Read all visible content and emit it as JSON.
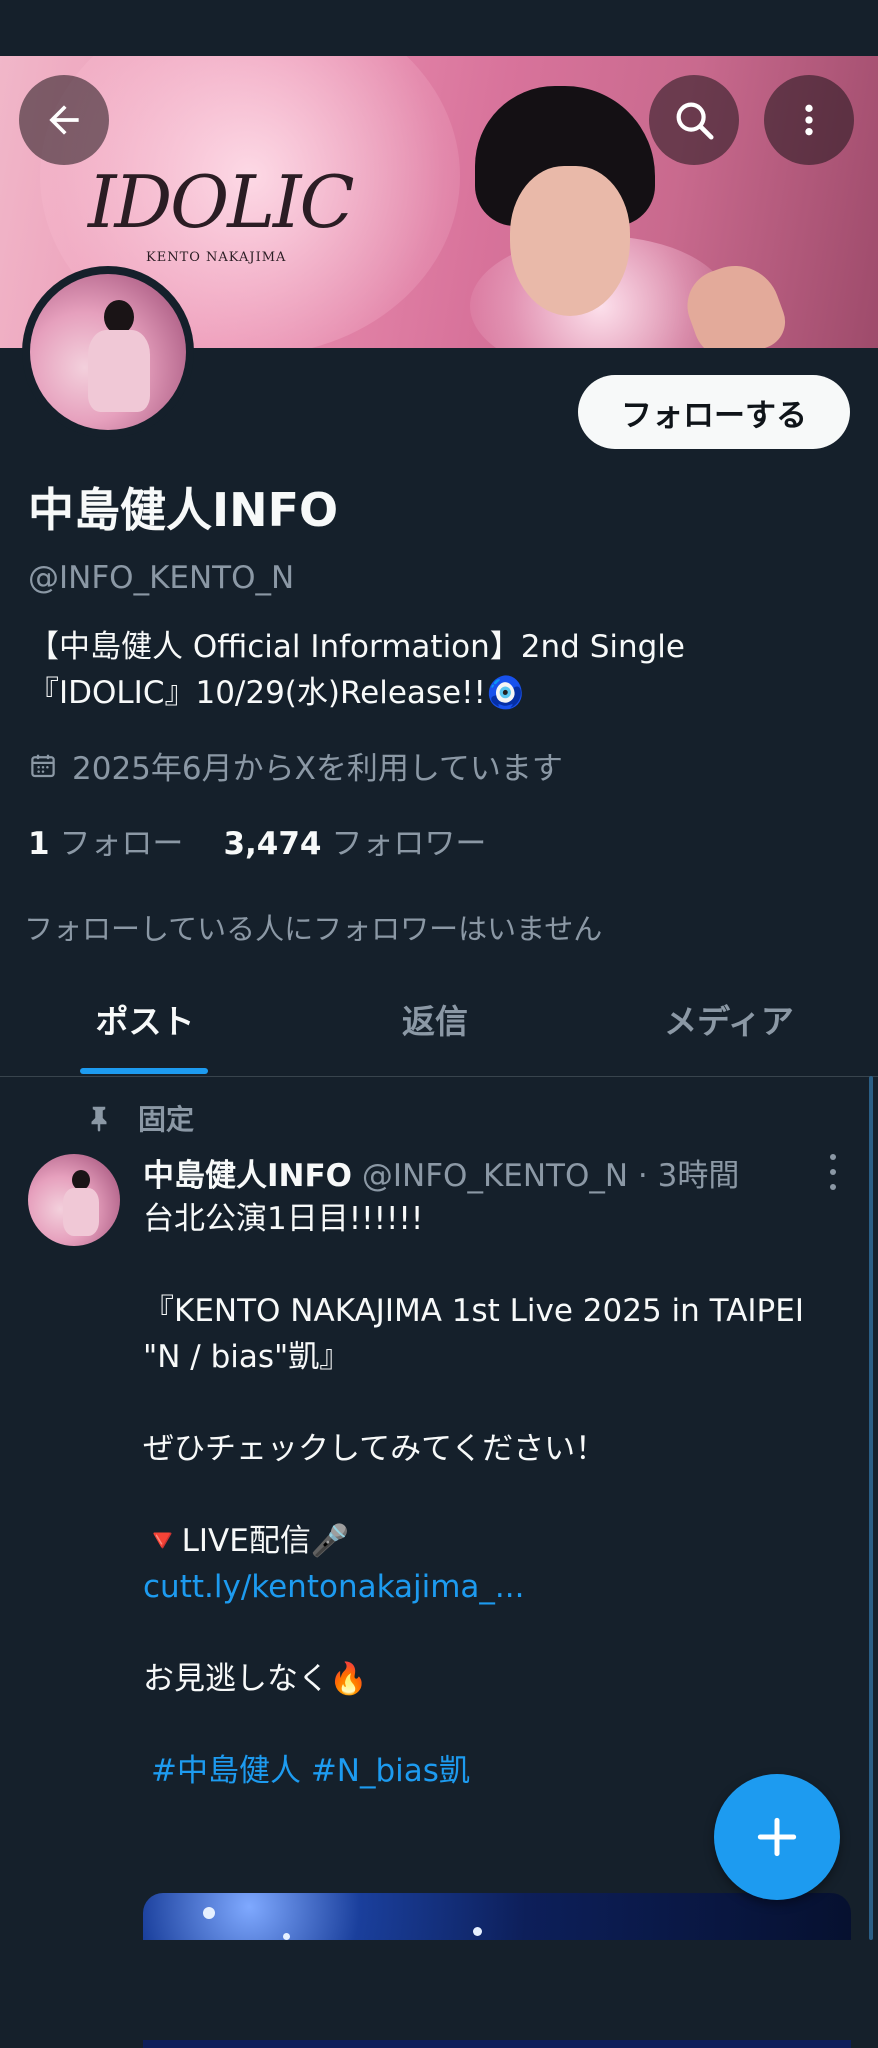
{
  "banner": {
    "title": "IDOLIC",
    "subtitle": "KENTO NAKAJIMA",
    "icons": [
      "back-arrow-icon",
      "search-icon",
      "more-vertical-icon"
    ]
  },
  "profile": {
    "follow_label": "フォローする",
    "name": "中島健人INFO",
    "handle": "@INFO_KENTO_N",
    "bio_line1": "【中島健人 Official Information】2nd Single",
    "bio_line2": "『IDOLIC』10/29(水)Release!!",
    "bio_emoji": "🧿",
    "joined": "2025年6月からXを利用しています",
    "following_count": "1",
    "following_label": "フォロー",
    "followers_count": "3,474",
    "followers_label": "フォロワー",
    "mutual_note": "フォローしている人にフォロワーはいません"
  },
  "tabs": [
    {
      "label": "ポスト",
      "active": true
    },
    {
      "label": "返信",
      "active": false
    },
    {
      "label": "メディア",
      "active": false
    }
  ],
  "post": {
    "pinned_label": "固定",
    "author_name": "中島健人INFO",
    "author_meta": "@INFO_KENTO_N · 3時間",
    "line1": "台北公演1日目!!!!!!",
    "line2": "『KENTO NAKAJIMA 1st Live 2025 in TAIPEI",
    "line3": "\"N / bias\"凱』",
    "line4": "ぜひチェックしてみてください！",
    "line5_marker": "🔻",
    "line5": "LIVE配信",
    "line5_emoji": "🎤",
    "link": "cutt.ly/kentonakajima_...",
    "line6": "お見逃しなく",
    "line6_emoji": "🔥",
    "hashtags": "#中島健人 #N_bias凱"
  },
  "colors": {
    "background": "#15202b",
    "accent": "#1d9bf0",
    "text_primary": "#f7f9f9",
    "text_secondary": "#8b98a5"
  },
  "fab_icon": "plus-icon"
}
